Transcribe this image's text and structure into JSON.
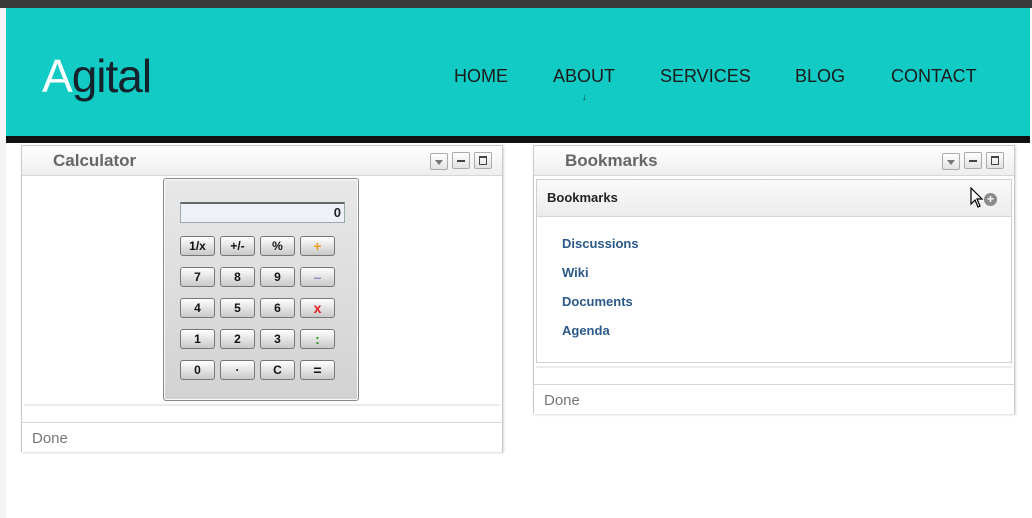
{
  "site": {
    "logo_first": "A",
    "logo_rest": "gital",
    "nav": [
      {
        "label": "HOME"
      },
      {
        "label": "ABOUT"
      },
      {
        "label": "SERVICES"
      },
      {
        "label": "BLOG"
      },
      {
        "label": "CONTACT"
      }
    ],
    "about_indicator": "↓"
  },
  "colors": {
    "header_bg": "#11cbc4",
    "link": "#2a5a8a",
    "subtract_key": "#8a8ac8",
    "multiply_key": "#e02020",
    "add_key": "#e8a020",
    "divide_key": "#20a020"
  },
  "calculator": {
    "title": "Calculator",
    "display": "0",
    "keys": [
      [
        "1/x",
        "+/-",
        "%",
        "+"
      ],
      [
        "7",
        "8",
        "9",
        "–"
      ],
      [
        "4",
        "5",
        "6",
        "x"
      ],
      [
        "1",
        "2",
        "3",
        ":"
      ],
      [
        "0",
        "·",
        "C",
        "="
      ]
    ],
    "status": "Done"
  },
  "bookmarks": {
    "title": "Bookmarks",
    "section_title": "Bookmarks",
    "links": [
      "Discussions",
      "Wiki",
      "Documents",
      "Agenda"
    ],
    "status": "Done"
  },
  "icons": [
    "menu-dropdown-icon",
    "minimize-icon",
    "maximize-icon",
    "add-circle-icon",
    "mouse-cursor-icon"
  ]
}
